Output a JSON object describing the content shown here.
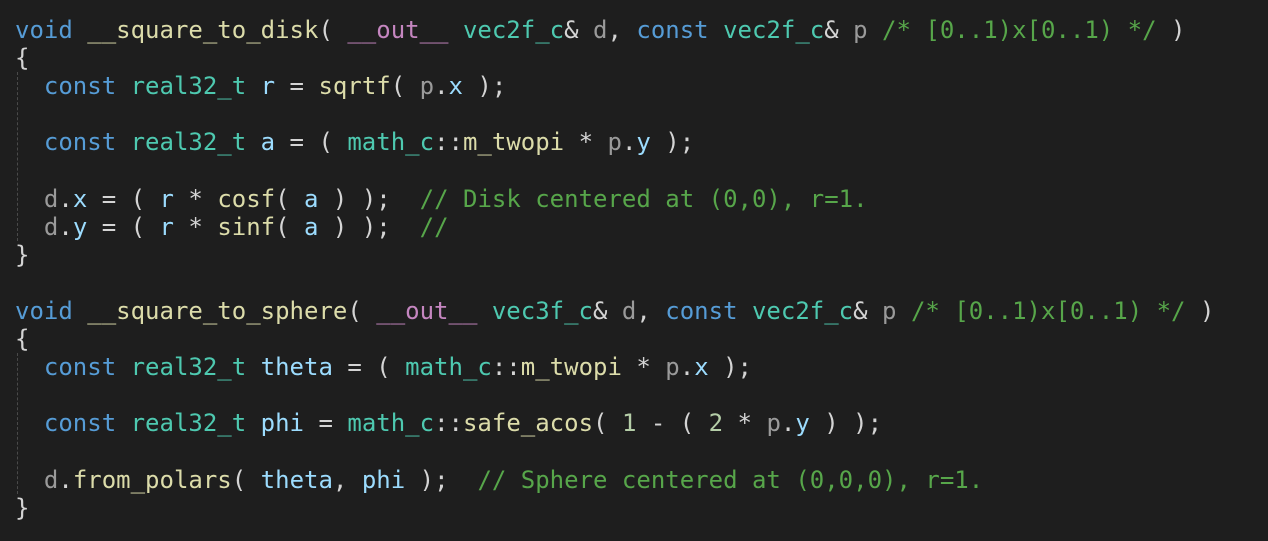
{
  "palette": {
    "background": "#1e1e1e",
    "keyword": "#569cd6",
    "type": "#4ec9b0",
    "function": "#dcdcaa",
    "variable": "#9cdcfe",
    "parameter": "#9a9a9a",
    "comment": "#57a64a",
    "macro": "#c586c0",
    "number": "#b5cea8",
    "plain": "#d4d4d4"
  },
  "code": {
    "lines": [
      [
        [
          "kw",
          "void"
        ],
        [
          "pl",
          " "
        ],
        [
          "fn",
          "__square_to_disk"
        ],
        [
          "pl",
          "( "
        ],
        [
          "mc",
          "__out__"
        ],
        [
          "pl",
          " "
        ],
        [
          "ty",
          "vec2f_c"
        ],
        [
          "pl",
          "& "
        ],
        [
          "pa",
          "d"
        ],
        [
          "pl",
          ", "
        ],
        [
          "kw",
          "const"
        ],
        [
          "pl",
          " "
        ],
        [
          "ty",
          "vec2f_c"
        ],
        [
          "pl",
          "& "
        ],
        [
          "pa",
          "p"
        ],
        [
          "pl",
          " "
        ],
        [
          "cm",
          "/* [0..1)x[0..1) */"
        ],
        [
          "pl",
          " )"
        ]
      ],
      [
        [
          "pl",
          "{"
        ]
      ],
      [
        [
          "pl",
          "  "
        ],
        [
          "kw",
          "const"
        ],
        [
          "pl",
          " "
        ],
        [
          "ty",
          "real32_t"
        ],
        [
          "pl",
          " "
        ],
        [
          "va",
          "r"
        ],
        [
          "pl",
          " = "
        ],
        [
          "fn",
          "sqrtf"
        ],
        [
          "pl",
          "( "
        ],
        [
          "pa",
          "p"
        ],
        [
          "pl",
          "."
        ],
        [
          "va",
          "x"
        ],
        [
          "pl",
          " );"
        ]
      ],
      [],
      [
        [
          "pl",
          "  "
        ],
        [
          "kw",
          "const"
        ],
        [
          "pl",
          " "
        ],
        [
          "ty",
          "real32_t"
        ],
        [
          "pl",
          " "
        ],
        [
          "va",
          "a"
        ],
        [
          "pl",
          " = ( "
        ],
        [
          "ty",
          "math_c"
        ],
        [
          "pl",
          "::"
        ],
        [
          "fn",
          "m_twopi"
        ],
        [
          "pl",
          " * "
        ],
        [
          "pa",
          "p"
        ],
        [
          "pl",
          "."
        ],
        [
          "va",
          "y"
        ],
        [
          "pl",
          " );"
        ]
      ],
      [],
      [
        [
          "pl",
          "  "
        ],
        [
          "pa",
          "d"
        ],
        [
          "pl",
          "."
        ],
        [
          "va",
          "x"
        ],
        [
          "pl",
          " = ( "
        ],
        [
          "va",
          "r"
        ],
        [
          "pl",
          " * "
        ],
        [
          "fn",
          "cosf"
        ],
        [
          "pl",
          "( "
        ],
        [
          "va",
          "a"
        ],
        [
          "pl",
          " ) );  "
        ],
        [
          "cm",
          "// Disk centered at (0,0), r=1."
        ]
      ],
      [
        [
          "pl",
          "  "
        ],
        [
          "pa",
          "d"
        ],
        [
          "pl",
          "."
        ],
        [
          "va",
          "y"
        ],
        [
          "pl",
          " = ( "
        ],
        [
          "va",
          "r"
        ],
        [
          "pl",
          " * "
        ],
        [
          "fn",
          "sinf"
        ],
        [
          "pl",
          "( "
        ],
        [
          "va",
          "a"
        ],
        [
          "pl",
          " ) );  "
        ],
        [
          "cm",
          "//"
        ]
      ],
      [
        [
          "pl",
          "}"
        ]
      ],
      [],
      [
        [
          "kw",
          "void"
        ],
        [
          "pl",
          " "
        ],
        [
          "fn",
          "__square_to_sphere"
        ],
        [
          "pl",
          "( "
        ],
        [
          "mc",
          "__out__"
        ],
        [
          "pl",
          " "
        ],
        [
          "ty",
          "vec3f_c"
        ],
        [
          "pl",
          "& "
        ],
        [
          "pa",
          "d"
        ],
        [
          "pl",
          ", "
        ],
        [
          "kw",
          "const"
        ],
        [
          "pl",
          " "
        ],
        [
          "ty",
          "vec2f_c"
        ],
        [
          "pl",
          "& "
        ],
        [
          "pa",
          "p"
        ],
        [
          "pl",
          " "
        ],
        [
          "cm",
          "/* [0..1)x[0..1) */"
        ],
        [
          "pl",
          " )"
        ]
      ],
      [
        [
          "pl",
          "{"
        ]
      ],
      [
        [
          "pl",
          "  "
        ],
        [
          "kw",
          "const"
        ],
        [
          "pl",
          " "
        ],
        [
          "ty",
          "real32_t"
        ],
        [
          "pl",
          " "
        ],
        [
          "va",
          "theta"
        ],
        [
          "pl",
          " = ( "
        ],
        [
          "ty",
          "math_c"
        ],
        [
          "pl",
          "::"
        ],
        [
          "fn",
          "m_twopi"
        ],
        [
          "pl",
          " * "
        ],
        [
          "pa",
          "p"
        ],
        [
          "pl",
          "."
        ],
        [
          "va",
          "x"
        ],
        [
          "pl",
          " );"
        ]
      ],
      [],
      [
        [
          "pl",
          "  "
        ],
        [
          "kw",
          "const"
        ],
        [
          "pl",
          " "
        ],
        [
          "ty",
          "real32_t"
        ],
        [
          "pl",
          " "
        ],
        [
          "va",
          "phi"
        ],
        [
          "pl",
          " = "
        ],
        [
          "ty",
          "math_c"
        ],
        [
          "pl",
          "::"
        ],
        [
          "fn",
          "safe_acos"
        ],
        [
          "pl",
          "( "
        ],
        [
          "nu",
          "1"
        ],
        [
          "pl",
          " - ( "
        ],
        [
          "nu",
          "2"
        ],
        [
          "pl",
          " * "
        ],
        [
          "pa",
          "p"
        ],
        [
          "pl",
          "."
        ],
        [
          "va",
          "y"
        ],
        [
          "pl",
          " ) );"
        ]
      ],
      [],
      [
        [
          "pl",
          "  "
        ],
        [
          "pa",
          "d"
        ],
        [
          "pl",
          "."
        ],
        [
          "fn",
          "from_polars"
        ],
        [
          "pl",
          "( "
        ],
        [
          "va",
          "theta"
        ],
        [
          "pl",
          ", "
        ],
        [
          "va",
          "phi"
        ],
        [
          "pl",
          " );  "
        ],
        [
          "cm",
          "// Sphere centered at (0,0,0), r=1."
        ]
      ],
      [
        [
          "pl",
          "}"
        ]
      ]
    ]
  }
}
